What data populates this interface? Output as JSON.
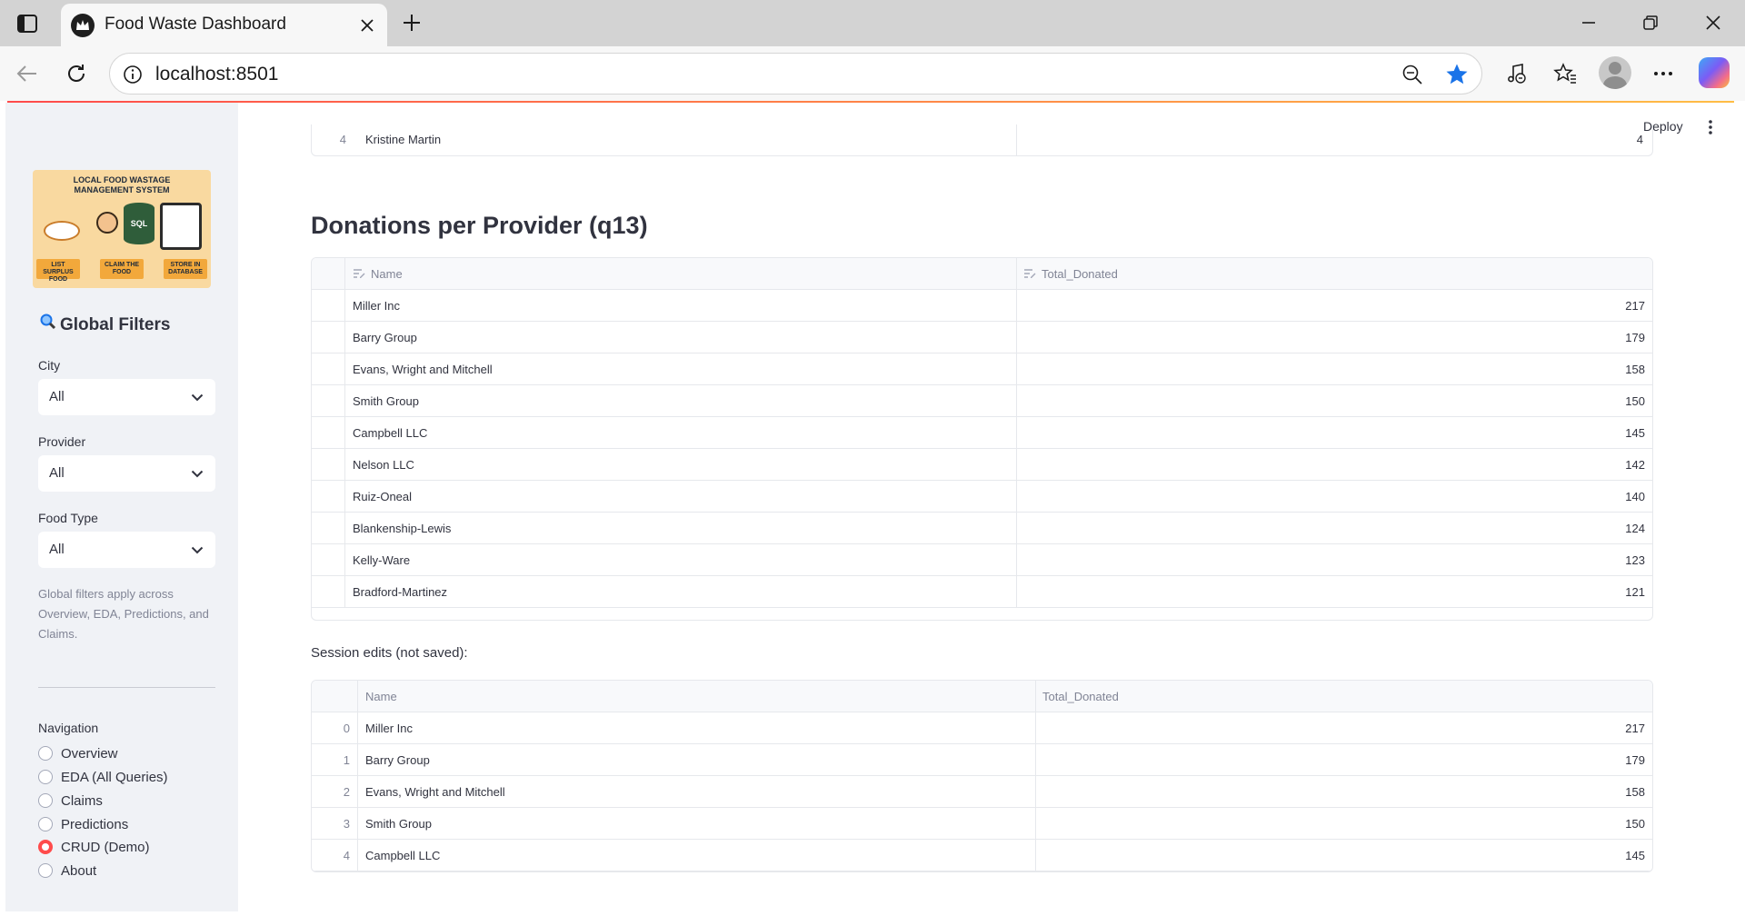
{
  "browser": {
    "tab_title": "Food Waste Dashboard",
    "url": "localhost:8501"
  },
  "colors": {
    "accent": "#ff4b4b",
    "sidebar_bg": "#f0f2f6",
    "star": "#1a73e8"
  },
  "header": {
    "deploy_label": "Deploy"
  },
  "sidebar": {
    "logo": {
      "title_line1": "LOCAL FOOD WASTAGE",
      "title_line2": "MANAGEMENT SYSTEM",
      "db_label": "SQL",
      "step1": "LIST SURPLUS FOOD",
      "step2": "CLAIM THE FOOD",
      "step3": "STORE IN DATABASE"
    },
    "filters_title": "Global Filters",
    "city_label": "City",
    "city_value": "All",
    "provider_label": "Provider",
    "provider_value": "All",
    "food_type_label": "Food Type",
    "food_type_value": "All",
    "caption": "Global filters apply across Overview, EDA, Predictions, and Claims.",
    "nav_label": "Navigation",
    "nav_items": [
      "Overview",
      "EDA (All Queries)",
      "Claims",
      "Predictions",
      "CRUD (Demo)",
      "About"
    ],
    "nav_selected": "CRUD (Demo)"
  },
  "main": {
    "previous_row": {
      "index": "4",
      "name": "Kristine Martin",
      "value": "4"
    },
    "section_title": "Donations per Provider (q13)",
    "editor": {
      "columns": [
        "Name",
        "Total_Donated"
      ],
      "rows": [
        {
          "name": "Miller Inc",
          "total": "217"
        },
        {
          "name": "Barry Group",
          "total": "179"
        },
        {
          "name": "Evans, Wright and Mitchell",
          "total": "158"
        },
        {
          "name": "Smith Group",
          "total": "150"
        },
        {
          "name": "Campbell LLC",
          "total": "145"
        },
        {
          "name": "Nelson LLC",
          "total": "142"
        },
        {
          "name": "Ruiz-Oneal",
          "total": "140"
        },
        {
          "name": "Blankenship-Lewis",
          "total": "124"
        },
        {
          "name": "Kelly-Ware",
          "total": "123"
        },
        {
          "name": "Bradford-Martinez",
          "total": "121"
        }
      ]
    },
    "session_label": "Session edits (not saved):",
    "session_table": {
      "columns": [
        "Name",
        "Total_Donated"
      ],
      "rows": [
        {
          "index": "0",
          "name": "Miller Inc",
          "total": "217"
        },
        {
          "index": "1",
          "name": "Barry Group",
          "total": "179"
        },
        {
          "index": "2",
          "name": "Evans, Wright and Mitchell",
          "total": "158"
        },
        {
          "index": "3",
          "name": "Smith Group",
          "total": "150"
        },
        {
          "index": "4",
          "name": "Campbell LLC",
          "total": "145"
        }
      ]
    }
  }
}
